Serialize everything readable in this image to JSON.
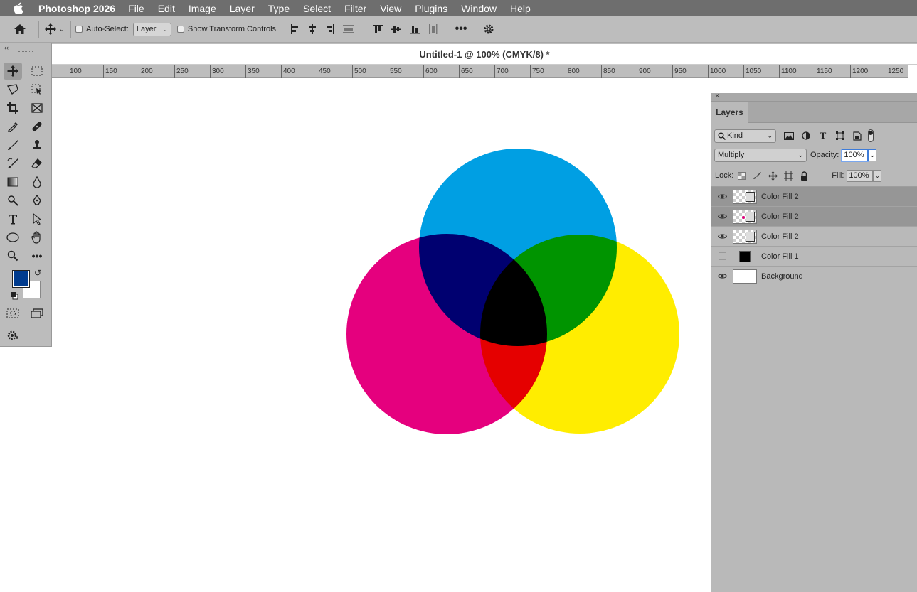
{
  "menubar": {
    "app_name": "Photoshop 2026",
    "items": [
      "File",
      "Edit",
      "Image",
      "Layer",
      "Type",
      "Select",
      "Filter",
      "View",
      "Plugins",
      "Window",
      "Help"
    ]
  },
  "options": {
    "auto_select_label": "Auto-Select:",
    "auto_select_value": "Layer",
    "show_transform_label": "Show Transform Controls"
  },
  "document": {
    "title": "Untitled-1 @ 100% (CMYK/8) *"
  },
  "ruler": {
    "ticks": [
      "100",
      "150",
      "200",
      "250",
      "300",
      "350",
      "400",
      "450",
      "500",
      "550",
      "600",
      "650",
      "700",
      "750",
      "800",
      "850",
      "900",
      "950",
      "1000",
      "1050",
      "1100",
      "1150",
      "1200",
      "1250"
    ]
  },
  "colors": {
    "foreground": "#003b8e",
    "background": "#ffffff",
    "cyan": "#009fe3",
    "magenta": "#e5007e",
    "yellow": "#ffed00"
  },
  "layers_panel": {
    "tab": "Layers",
    "filter_kind": "Kind",
    "blend_mode": "Multiply",
    "opacity_label": "Opacity:",
    "opacity_value": "100%",
    "lock_label": "Lock:",
    "fill_label": "Fill:",
    "fill_value": "100%",
    "layers": [
      {
        "name": "Color Fill 2",
        "visible": true,
        "selected": true
      },
      {
        "name": "Color Fill 2",
        "visible": true,
        "selected": true
      },
      {
        "name": "Color Fill 2",
        "visible": true,
        "selected": false
      },
      {
        "name": "Color Fill 1",
        "visible": false,
        "selected": false
      },
      {
        "name": "Background",
        "visible": true,
        "selected": false
      }
    ]
  }
}
